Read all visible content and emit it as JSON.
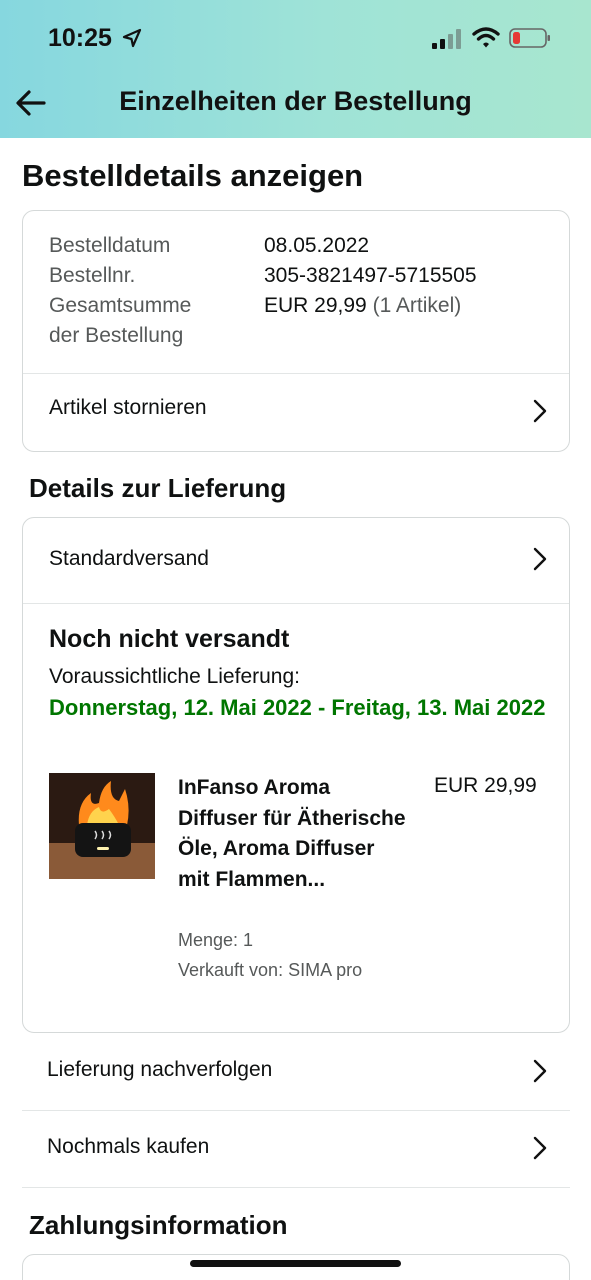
{
  "status_bar": {
    "time": "10:25",
    "icons": [
      "location-arrow-icon",
      "cellular-signal-icon",
      "wifi-icon",
      "battery-low-icon"
    ],
    "battery_color": "#e53935"
  },
  "nav": {
    "back_icon": "back-arrow-icon",
    "title": "Einzelheiten der Bestellung"
  },
  "page_title": "Bestelldetails anzeigen",
  "order_summary": {
    "date_label": "Bestelldatum",
    "date_value": "08.05.2022",
    "number_label": "Bestellnr.",
    "number_value": "305-3821497-5715505",
    "total_label_line1": "Gesamtsumme",
    "total_label_line2": "der Bestellung",
    "total_value": "EUR 29,99",
    "total_items": "(1 Artikel)",
    "cancel_label": "Artikel stornieren"
  },
  "delivery": {
    "heading": "Details zur Lieferung",
    "shipping_method": "Standardversand",
    "status": "Noch nicht versandt",
    "eta_label": "Voraussichtliche Lieferung:",
    "eta_range": "Donnerstag, 12. Mai 2022 - Freitag, 13. Mai 2022",
    "eta_color": "#007600",
    "item": {
      "title": "InFanso Aroma Diffuser für Ätherische Öle, Aroma Diffuser mit Flammen...",
      "price": "EUR 29,99",
      "quantity": "Menge: 1",
      "seller": "Verkauft von: SIMA pro"
    }
  },
  "actions": {
    "track": "Lieferung nachverfolgen",
    "buy_again": "Nochmals kaufen"
  },
  "payment": {
    "heading": "Zahlungsinformation"
  }
}
